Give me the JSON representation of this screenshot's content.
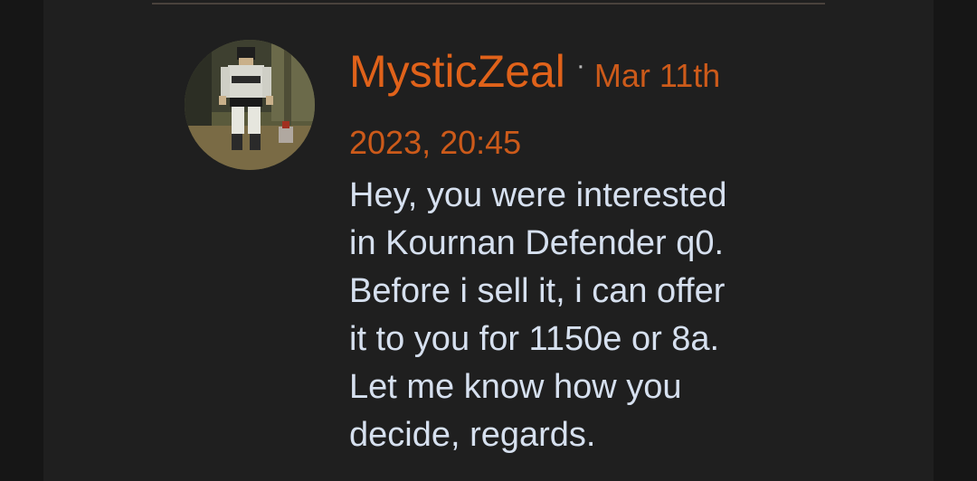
{
  "post": {
    "author": "MysticZeal",
    "separator": "·",
    "date_part1": "Mar 11th",
    "date_part2": "2023, 20:45",
    "message_lines": [
      "Hey, you were interested",
      "in Kournan Defender q0.",
      "Before i sell it, i can offer",
      "it to you for 1150e or 8a.",
      "Let me know how you",
      "decide, regards."
    ]
  },
  "colors": {
    "background": "#1f1f1f",
    "author": "#e0621a",
    "date": "#cc5a1a",
    "message": "#d6e0ef",
    "divider": "#4a423c"
  }
}
